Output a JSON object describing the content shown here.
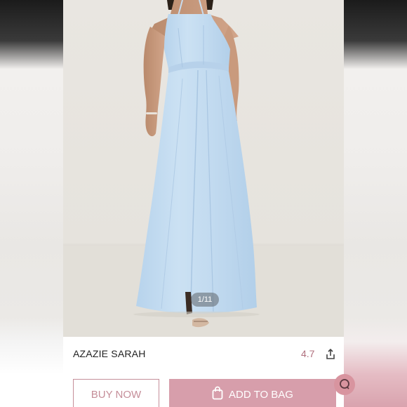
{
  "gallery": {
    "page_indicator": "1/11"
  },
  "product": {
    "name": "AZAZIE SARAH",
    "rating": "4.7"
  },
  "actions": {
    "buy_now_label": "BUY NOW",
    "add_to_bag_label": "ADD TO BAG"
  },
  "icons": {
    "share": "share-icon",
    "bag": "shopping-bag-icon",
    "chat": "chat-icon"
  },
  "colors": {
    "dress": "#c4dcf0",
    "accent_pink": "#d79eab",
    "rating": "#b0707e",
    "background": "#e9e6e1"
  }
}
